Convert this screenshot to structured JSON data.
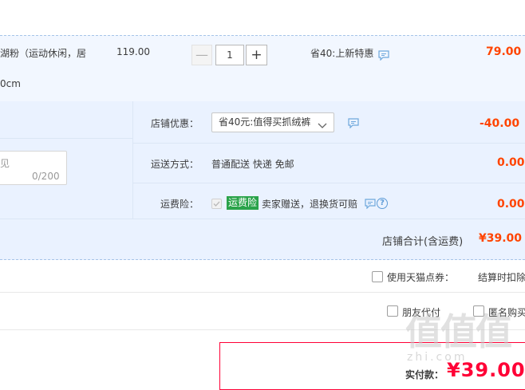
{
  "item": {
    "name_line1": "湖粉（运动休闲，居",
    "name_line2": "0cm",
    "unit_price": "119.00",
    "quantity": "1",
    "minus_label": "—",
    "plus_label": "+",
    "promo": "省40:上新特惠",
    "total": "79.00"
  },
  "message": {
    "placeholder": "见",
    "count": "0/200"
  },
  "shop": {
    "discount_label": "店铺优惠：",
    "discount_value": "省40元:值得买抓绒裤",
    "discount_amount": "-40.00",
    "shipping_label": "运送方式：",
    "shipping_value": "普通配送 快递 免邮",
    "shipping_amount": "0.00",
    "insurance_label": "运费险：",
    "insurance_badge": "运费险",
    "insurance_text": "卖家赠送，退换货可赔",
    "insurance_help": "?",
    "insurance_amount": "0.00",
    "total_label": "店铺合计(含运费)",
    "total_value": "¥39.00"
  },
  "options": {
    "tmall_points_label": "使用天猫点券：",
    "tmall_points_note": "结算时扣除",
    "friend_pay_label": "朋友代付",
    "anonymous_label": "匿名购买"
  },
  "payment": {
    "label": "实付款：",
    "amount": "¥39.00"
  },
  "watermark": {
    "big": "值值值",
    "small": "zhi.com"
  },
  "colors": {
    "accent": "#ff4400",
    "price_red": "#ff0036",
    "badge_green": "#2aa34a"
  }
}
